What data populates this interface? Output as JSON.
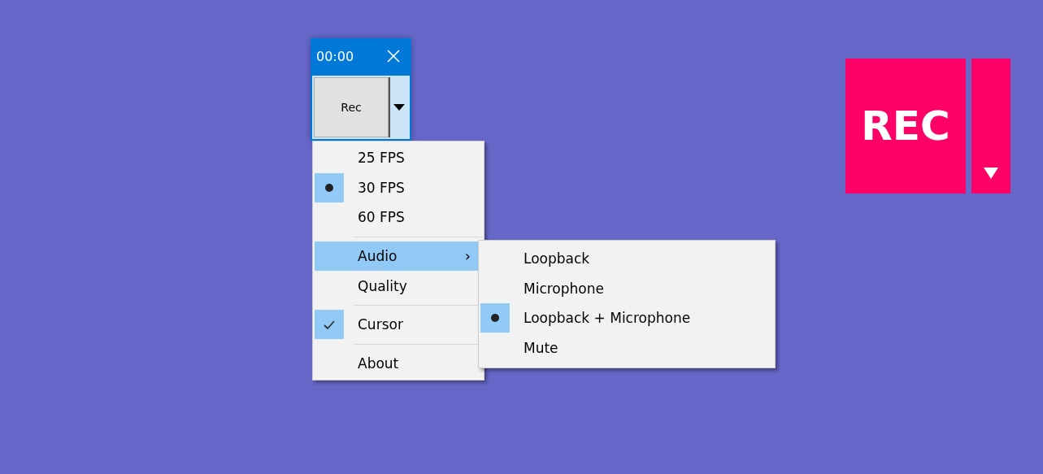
{
  "recorder": {
    "time": "00:00",
    "button": "Rec"
  },
  "menu": {
    "groups": [
      [
        {
          "kind": "radio",
          "label": "25 FPS",
          "selected": false
        },
        {
          "kind": "radio",
          "label": "30 FPS",
          "selected": true
        },
        {
          "kind": "radio",
          "label": "60 FPS",
          "selected": false
        }
      ],
      [
        {
          "kind": "submenu",
          "label": "Audio",
          "expanded": true,
          "arrow": "›"
        },
        {
          "kind": "command",
          "label": "Quality"
        }
      ],
      [
        {
          "kind": "check",
          "label": "Cursor",
          "checked": true
        }
      ],
      [
        {
          "kind": "command",
          "label": "About"
        }
      ]
    ]
  },
  "submenu": {
    "items": [
      {
        "label": "Loopback",
        "selected": false
      },
      {
        "label": "Microphone",
        "selected": false
      },
      {
        "label": "Loopback + Microphone",
        "selected": true
      },
      {
        "label": "Mute",
        "selected": false
      }
    ]
  },
  "big_button": {
    "label": "REC"
  }
}
